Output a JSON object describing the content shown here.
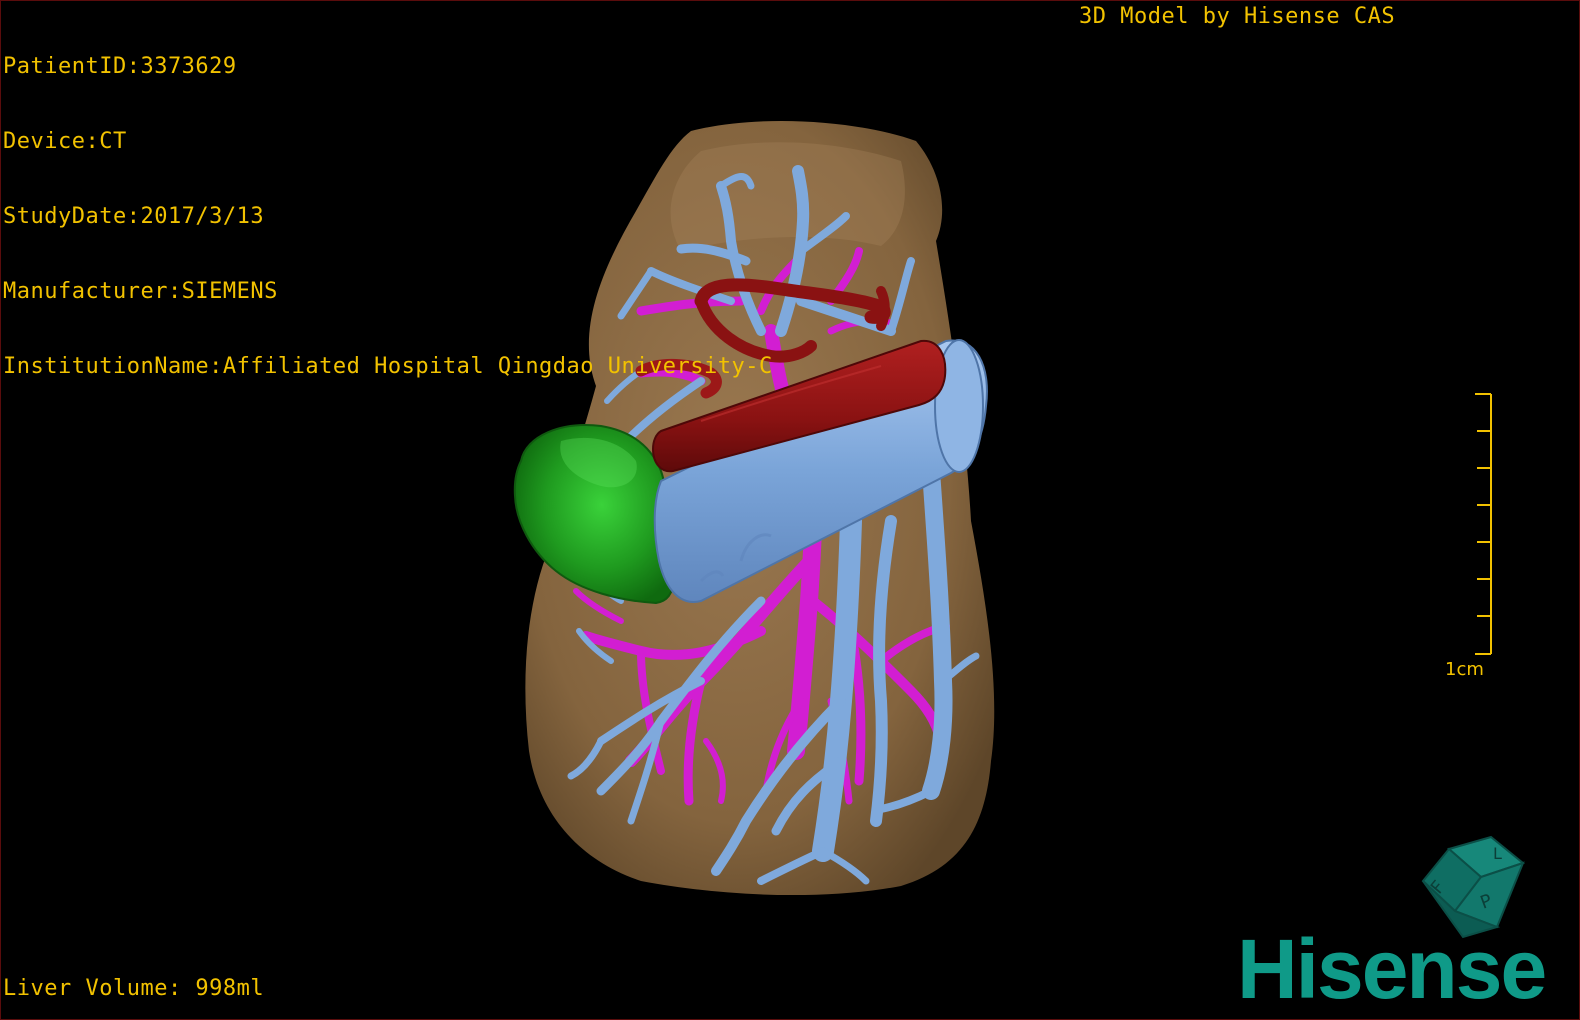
{
  "overlay": {
    "patient_id": "PatientID:3373629",
    "device": "Device:CT",
    "study_date": "StudyDate:2017/3/13",
    "manufacturer": "Manufacturer:SIEMENS",
    "institution": "InstitutionName:Affiliated Hospital Qingdao University-C",
    "credit": "3D Model by Hisense CAS",
    "liver_volume": "Liver Volume: 998ml"
  },
  "scale": {
    "label": "1cm"
  },
  "brand": {
    "logo_text": "Hisense"
  },
  "colors": {
    "background": "#000000",
    "overlay_text": "#f2c200",
    "liver": "#8b6a42",
    "portal_vein": "#7fa9dc",
    "hepatic_vein": "#d21ed2",
    "artery": "#8a1414",
    "tumor": "#1f9a1f",
    "brand": "#0f9a88"
  },
  "icons": {
    "orientation_cube": "orientation-cube-icon"
  }
}
